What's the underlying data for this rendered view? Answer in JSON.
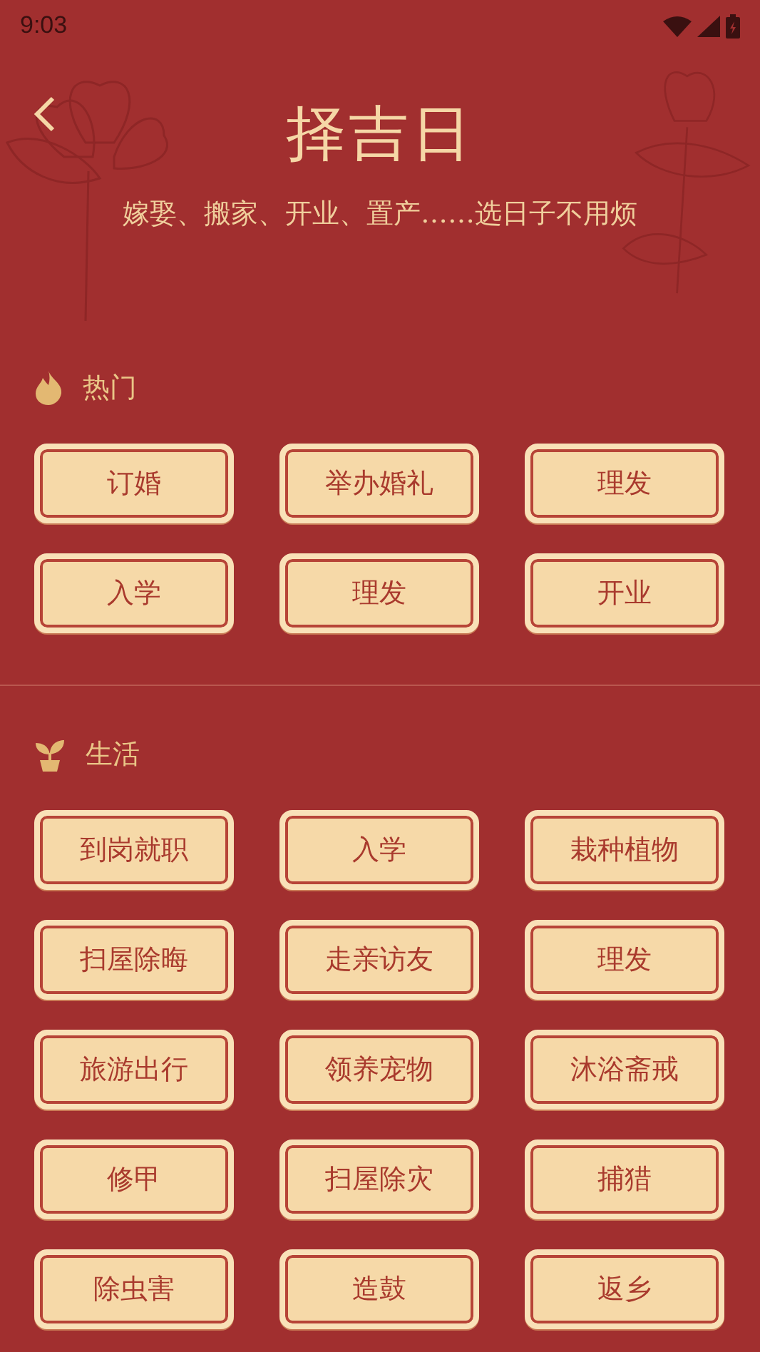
{
  "status_bar": {
    "time": "9:03"
  },
  "header": {
    "title": "择吉日",
    "subtitle": "嫁娶、搬家、开业、置产……选日子不用烦"
  },
  "sections": [
    {
      "kind": "hot",
      "title": "热门",
      "items": [
        "订婚",
        "举办婚礼",
        "理发",
        "入学",
        "理发",
        "开业"
      ]
    },
    {
      "kind": "life",
      "title": "生活",
      "items": [
        "到岗就职",
        "入学",
        "栽种植物",
        "扫屋除晦",
        "走亲访友",
        "理发",
        "旅游出行",
        "领养宠物",
        "沐浴斋戒",
        "修甲",
        "扫屋除灾",
        "捕猎",
        "除虫害",
        "造鼓",
        "返乡"
      ]
    }
  ]
}
